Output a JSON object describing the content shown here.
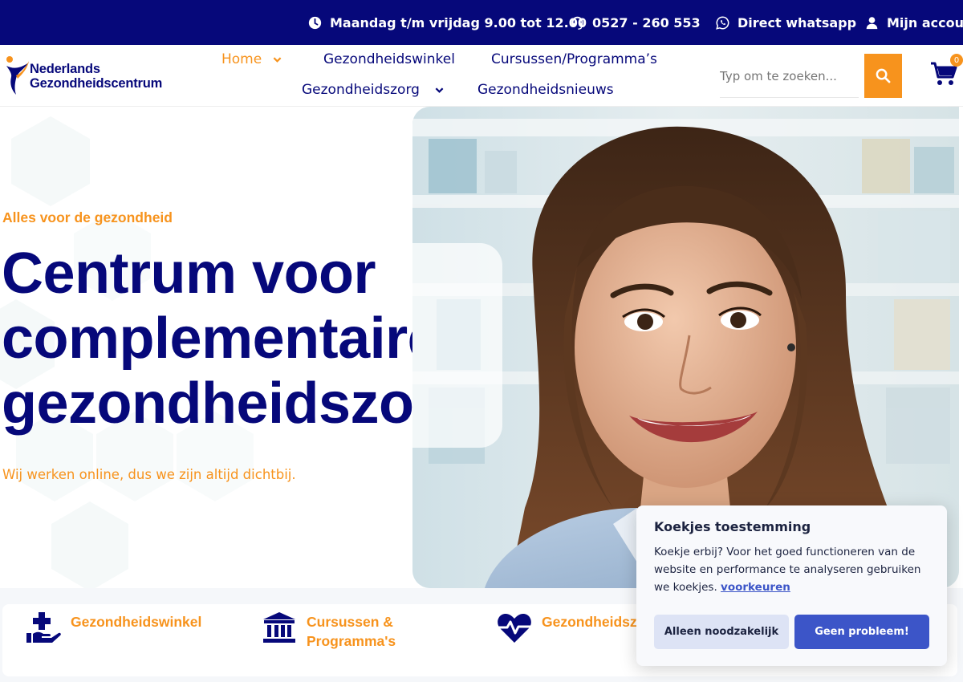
{
  "topbar": {
    "hours": "Maandag t/m vrijdag 9.00 tot 12.00",
    "phone": "0527 - 260 553",
    "whatsapp": "Direct whatsapp",
    "account": "Mijn account",
    "icons": [
      "clock-icon",
      "headset-icon",
      "whatsapp-icon",
      "user-icon"
    ]
  },
  "logo": {
    "line1": "Nederlands",
    "line2": "Gezondheidscentrum"
  },
  "nav": {
    "items": [
      {
        "label": "Home",
        "active": true,
        "has_dropdown": true
      },
      {
        "label": "Gezondheidswinkel",
        "active": false,
        "has_dropdown": false
      },
      {
        "label": "Cursussen/Programma’s",
        "active": false,
        "has_dropdown": false
      },
      {
        "label": "Gezondheidszorg",
        "active": false,
        "has_dropdown": true
      },
      {
        "label": "Gezondheidsnieuws",
        "active": false,
        "has_dropdown": false
      }
    ]
  },
  "search": {
    "placeholder": "Typ om te zoeken...",
    "button_icon": "search-icon"
  },
  "cart": {
    "count": "0",
    "icon": "cart-icon"
  },
  "hero": {
    "eyebrow": "Alles voor de gezondheid",
    "headline_lines": [
      "Centrum voor",
      "complementaire",
      "gezondheidszorg"
    ],
    "subline": "Wij werken online, dus we zijn altijd dichtbij."
  },
  "features": [
    {
      "icon": "hand-plus-icon",
      "lines": [
        "Gezondheidswinkel"
      ]
    },
    {
      "icon": "institution-icon",
      "lines": [
        "Cursussen &",
        "Programma's"
      ]
    },
    {
      "icon": "heartbeat-icon",
      "lines": [
        "Gezondheidszorg"
      ]
    }
  ],
  "cookie": {
    "title": "Koekjes toestemming",
    "text": "Koekje erbij? Voor het goed functioneren van de website en performance te analyseren gebruiken we koekjes.",
    "link": "voorkeuren",
    "btn_necessary": "Alleen noodzakelijk",
    "btn_accept": "Geen probleem!"
  },
  "colors": {
    "navy": "#06087a",
    "orange": "#f7931d",
    "cookie_blue": "#3c55c8"
  }
}
